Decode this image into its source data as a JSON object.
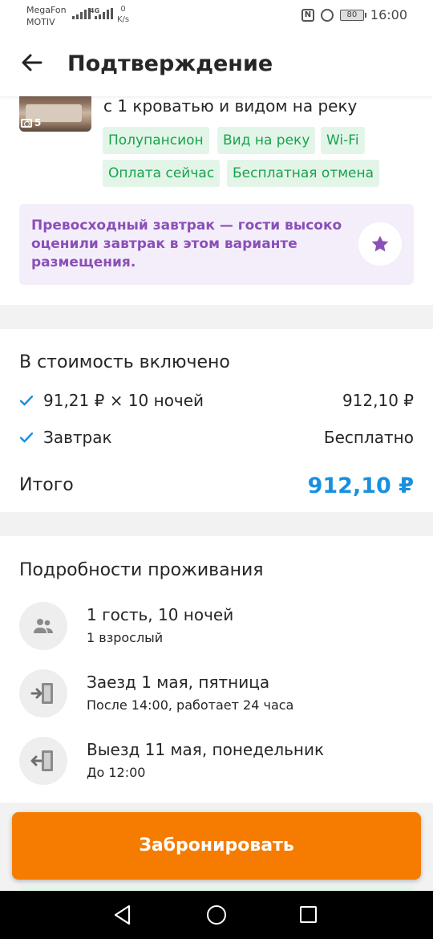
{
  "status_bar": {
    "carrier_line1": "MegaFon",
    "carrier_line2": "MOTIV",
    "network": "4G",
    "speed_value": "0",
    "speed_unit": "K/s",
    "battery": "80",
    "time": "16:00"
  },
  "header": {
    "title": "Подтверждение",
    "back_icon": "arrow-left-icon"
  },
  "room": {
    "photo_count": "5",
    "name_line": "с 1 кроватью и видом на реку",
    "tags": [
      "Полупансион",
      "Вид на реку",
      "Wi-Fi",
      "Оплата сейчас",
      "Бесплатная отмена"
    ],
    "tag_color": "#17a34a",
    "tag_bg": "#e3f5e9"
  },
  "promo": {
    "text": "Превосходный завтрак — гости высоко оценили завтрак в этом варианте размещения.",
    "icon": "star-icon",
    "color": "#8b4fb8"
  },
  "price": {
    "title": "В стоимость включено",
    "rows": [
      {
        "label": "91,21 ₽ × 10 ночей",
        "value": "912,10 ₽"
      },
      {
        "label": "Завтрак",
        "value": "Бесплатно"
      }
    ],
    "total_label": "Итого",
    "total_value": "912,10 ₽",
    "total_color": "#1a8fe0"
  },
  "stay": {
    "title": "Подробности проживания",
    "items": [
      {
        "icon": "guests-icon",
        "main": "1 гость, 10 ночей",
        "sub": "1 взрослый"
      },
      {
        "icon": "check-in-icon",
        "main": "Заезд 1 мая, пятница",
        "sub": "После 14:00, работает 24 часа"
      },
      {
        "icon": "check-out-icon",
        "main": "Выезд 11 мая, понедельник",
        "sub": "До 12:00"
      }
    ]
  },
  "book_button": {
    "label": "Забронировать",
    "color": "#f57c00"
  }
}
